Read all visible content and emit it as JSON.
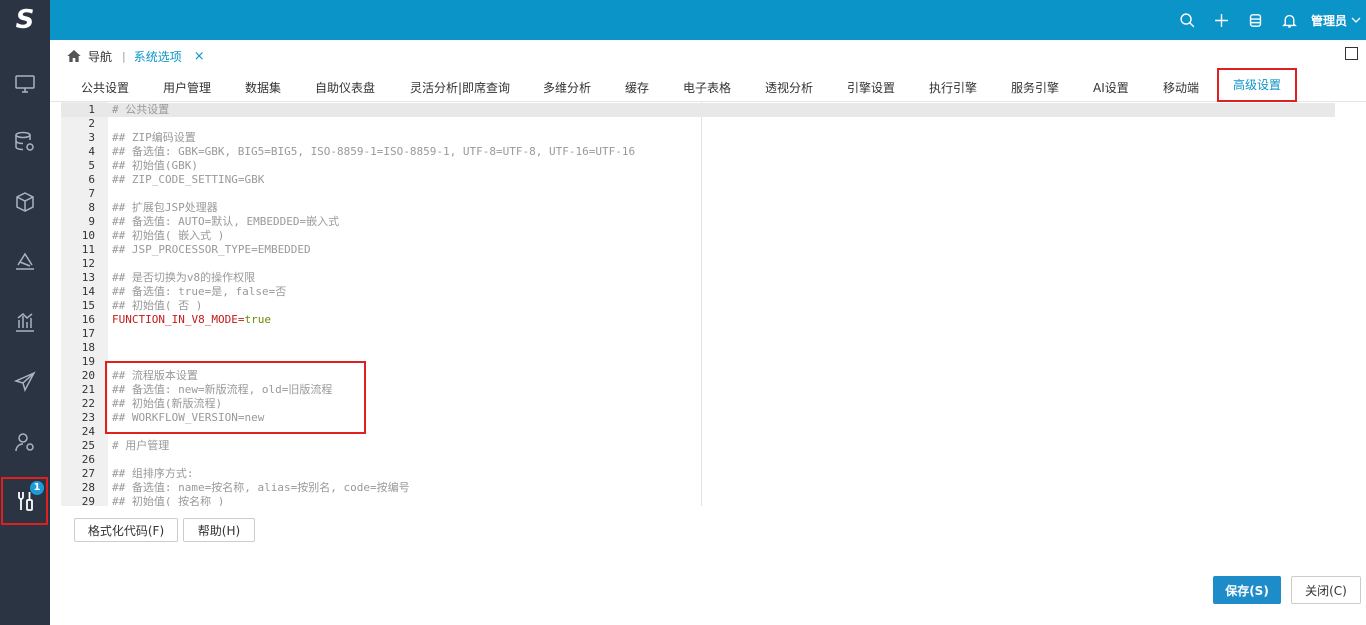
{
  "app": {
    "logo_text": "S"
  },
  "sidebar": {
    "items": [
      {
        "icon": "monitor-icon"
      },
      {
        "icon": "database-gear-icon"
      },
      {
        "icon": "cube-icon"
      },
      {
        "icon": "layers-icon"
      },
      {
        "icon": "bar-chart-icon"
      },
      {
        "icon": "paper-plane-icon"
      },
      {
        "icon": "user-gear-icon"
      },
      {
        "icon": "tools-icon",
        "badge": "1",
        "active": true
      }
    ]
  },
  "topbar": {
    "user": "管理员"
  },
  "breadcrumb": {
    "home": "导航",
    "separator": "|",
    "current": "系统选项",
    "close": "×"
  },
  "tabs": [
    "公共设置",
    "用户管理",
    "数据集",
    "自助仪表盘",
    "灵活分析|即席查询",
    "多维分析",
    "缓存",
    "电子表格",
    "透视分析",
    "引擎设置",
    "执行引擎",
    "服务引擎",
    "AI设置",
    "移动端",
    "高级设置"
  ],
  "selected_tab": "高级设置",
  "editor": {
    "lines": [
      {
        "n": "1",
        "t": "# 公共设置"
      },
      {
        "n": "2",
        "t": ""
      },
      {
        "n": "3",
        "t": "## ZIP编码设置"
      },
      {
        "n": "4",
        "t": "## 备选值: GBK=GBK, BIG5=BIG5, ISO-8859-1=ISO-8859-1, UTF-8=UTF-8, UTF-16=UTF-16"
      },
      {
        "n": "5",
        "t": "## 初始值(GBK)"
      },
      {
        "n": "6",
        "t": "## ZIP_CODE_SETTING=GBK"
      },
      {
        "n": "7",
        "t": ""
      },
      {
        "n": "8",
        "t": "## 扩展包JSP处理器"
      },
      {
        "n": "9",
        "t": "## 备选值: AUTO=默认, EMBEDDED=嵌入式"
      },
      {
        "n": "10",
        "t": "## 初始值( 嵌入式 )"
      },
      {
        "n": "11",
        "t": "## JSP_PROCESSOR_TYPE=EMBEDDED"
      },
      {
        "n": "12",
        "t": ""
      },
      {
        "n": "13",
        "t": "## 是否切换为v8的操作权限"
      },
      {
        "n": "14",
        "t": "## 备选值: true=是, false=否"
      },
      {
        "n": "15",
        "t": "## 初始值( 否 )"
      },
      {
        "n": "16",
        "key": "FUNCTION_IN_V8_MODE",
        "eq": "=",
        "val": "true"
      },
      {
        "n": "17",
        "t": ""
      },
      {
        "n": "18",
        "t": ""
      },
      {
        "n": "19",
        "t": ""
      },
      {
        "n": "20",
        "t": "## 流程版本设置"
      },
      {
        "n": "21",
        "t": "## 备选值: new=新版流程, old=旧版流程"
      },
      {
        "n": "22",
        "t": "## 初始值(新版流程)"
      },
      {
        "n": "23",
        "t": "## WORKFLOW_VERSION=new"
      },
      {
        "n": "24",
        "t": ""
      },
      {
        "n": "25",
        "t": "# 用户管理"
      },
      {
        "n": "26",
        "t": ""
      },
      {
        "n": "27",
        "t": "## 组排序方式:"
      },
      {
        "n": "28",
        "t": "## 备选值: name=按名称, alias=按别名, code=按编号"
      },
      {
        "n": "29",
        "t": "## 初始值( 按名称 )"
      }
    ]
  },
  "actions": {
    "format": "格式化代码(F)",
    "help": "帮助(H)",
    "save": "保存(S)",
    "close": "关闭(C)"
  },
  "colors": {
    "accent": "#0b94c8",
    "rail": "#2b3443",
    "highlight": "#e02020",
    "primary_button": "#1e8cc8"
  }
}
